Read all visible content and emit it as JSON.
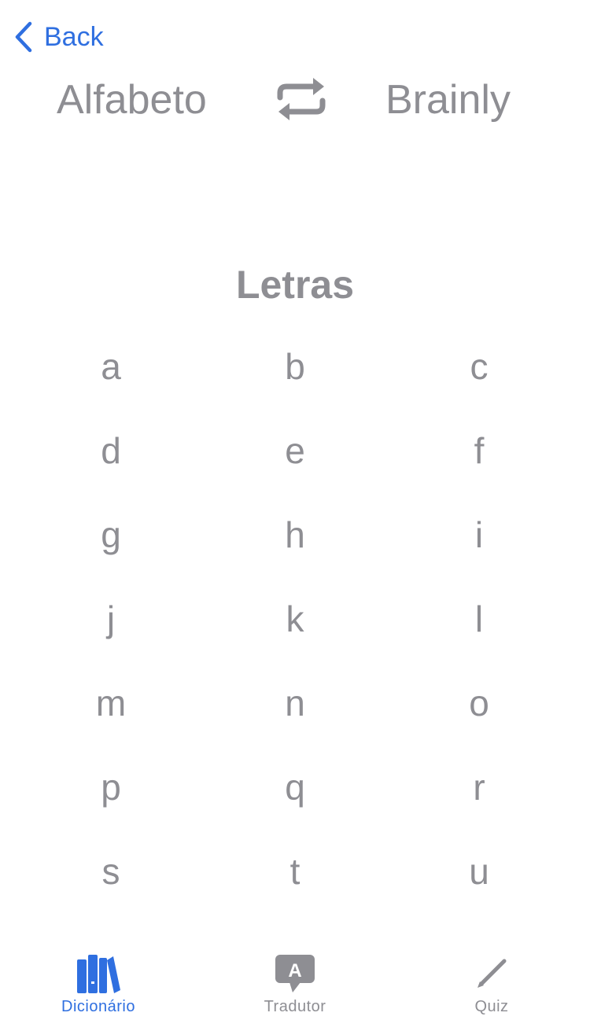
{
  "nav": {
    "back_label": "Back"
  },
  "languages": {
    "from": "Alfabeto",
    "to": "Brainly"
  },
  "section": {
    "title": "Letras"
  },
  "letters": [
    "a",
    "b",
    "c",
    "d",
    "e",
    "f",
    "g",
    "h",
    "i",
    "j",
    "k",
    "l",
    "m",
    "n",
    "o",
    "p",
    "q",
    "r",
    "s",
    "t",
    "u"
  ],
  "tabs": [
    {
      "label": "Dicionário",
      "icon": "books-icon",
      "active": true
    },
    {
      "label": "Tradutor",
      "icon": "translate-bubble-icon",
      "active": false
    },
    {
      "label": "Quiz",
      "icon": "pencil-icon",
      "active": false
    }
  ],
  "translate_icon_glyph": "A",
  "colors": {
    "accent": "#2f6fe0",
    "gray_text": "#8e8e93",
    "background": "#ffffff"
  }
}
